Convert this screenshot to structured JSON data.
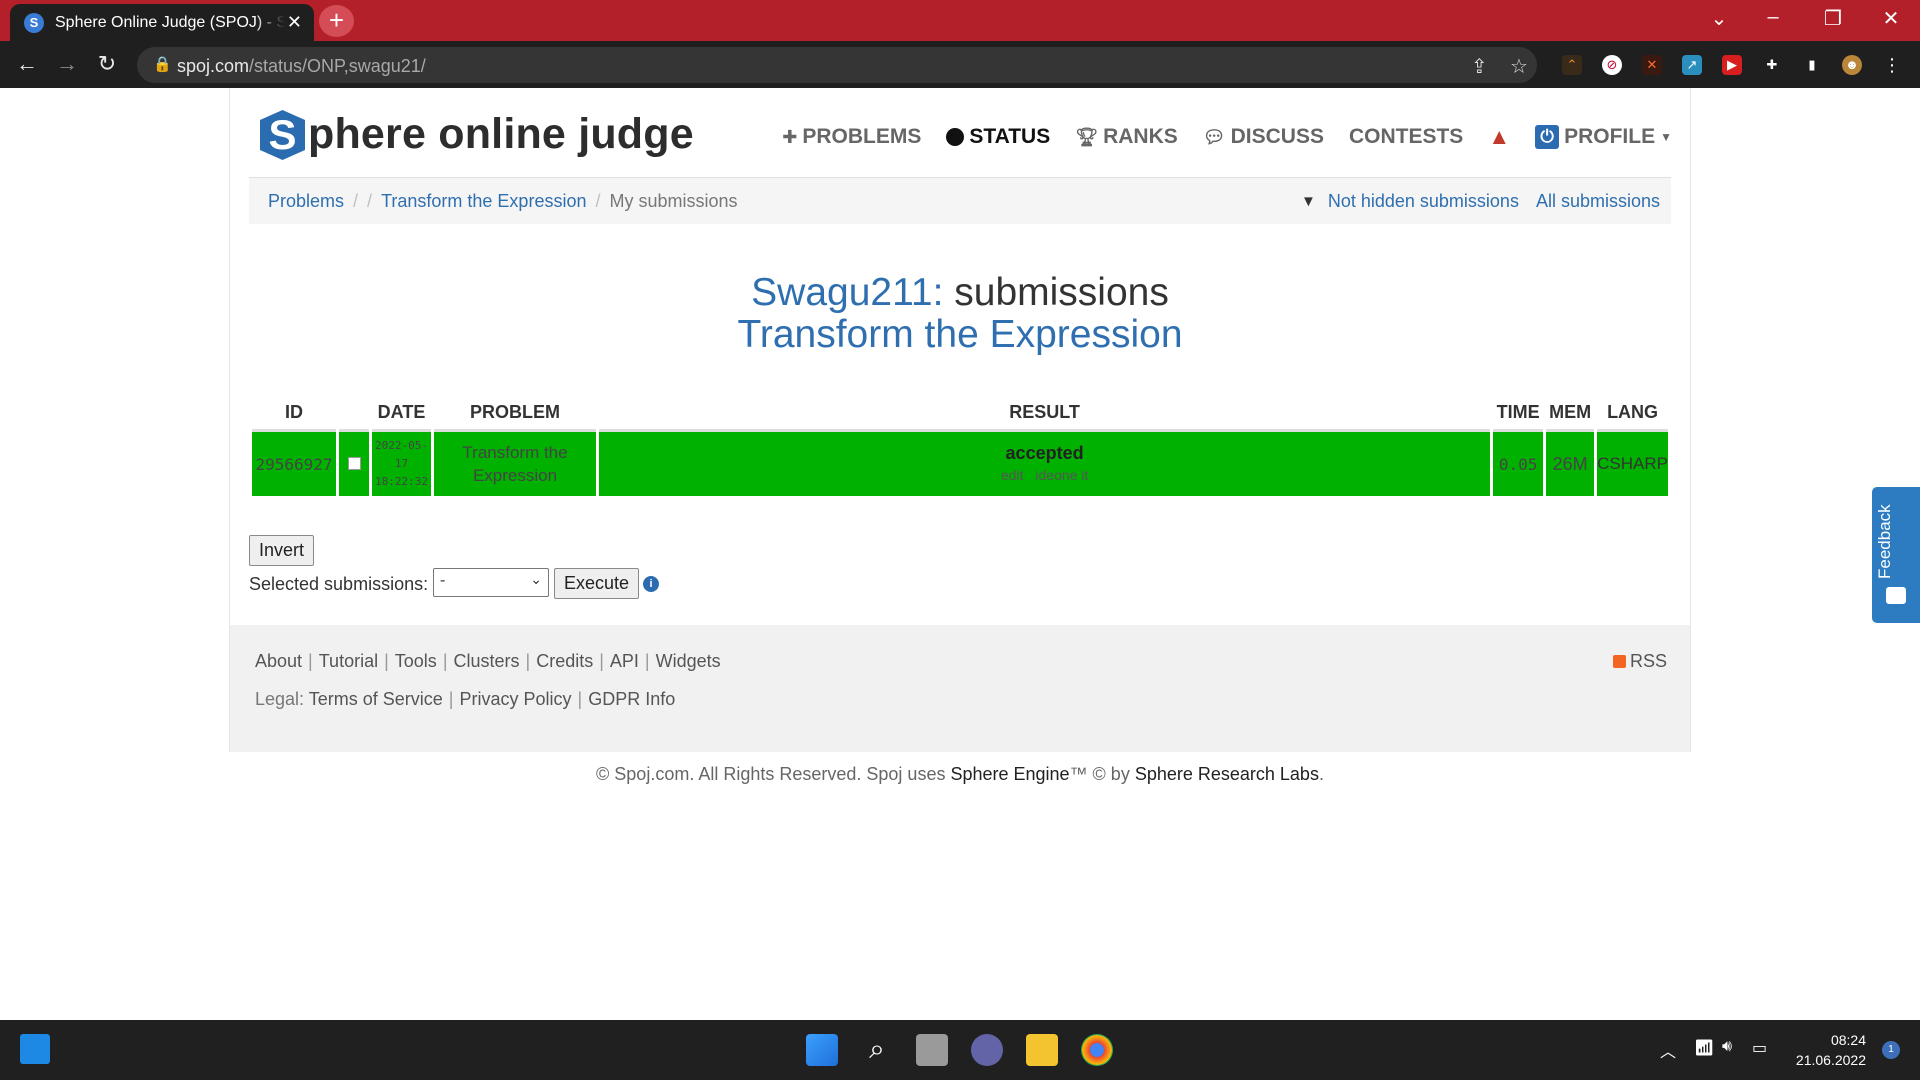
{
  "browser": {
    "tab_title": "Sphere Online Judge (SPOJ) - Status",
    "tab_favicon": "S",
    "new_tab": "+",
    "url_host": "spoj.com",
    "url_path": "/status/ONP,swagu21/"
  },
  "site": {
    "logo_letter": "S",
    "logo_text": "phere online judge",
    "nav": {
      "problems": "PROBLEMS",
      "status": "STATUS",
      "ranks": "RANKS",
      "discuss": "DISCUSS",
      "contests": "CONTESTS",
      "profile": "PROFILE"
    },
    "breadcrumb": {
      "problems": "Problems",
      "problem": "Transform the Expression",
      "current": "My submissions"
    },
    "filters": {
      "not_hidden": "Not hidden submissions",
      "all": "All submissions"
    },
    "heading": {
      "user": "Swagu211:",
      "word": "submissions",
      "problem": "Transform the Expression"
    },
    "table": {
      "headers": [
        "ID",
        "DATE",
        "PROBLEM",
        "RESULT",
        "TIME",
        "MEM",
        "LANG"
      ],
      "rows": [
        {
          "id": "29566927",
          "date": "2022-05-17",
          "time_of_day": "18:22:32",
          "problem": "Transform the Expression",
          "result": "accepted",
          "edit": "edit",
          "ideone": "ideone it",
          "time": "0.05",
          "mem": "26M",
          "lang": "CSHARP",
          "status_color": "#00b100"
        }
      ]
    },
    "invert_label": "Invert",
    "selected_label": "Selected submissions:",
    "select_value": "-",
    "execute_label": "Execute",
    "footer": {
      "links": [
        "About",
        "Tutorial",
        "Tools",
        "Clusters",
        "Credits",
        "API",
        "Widgets"
      ],
      "legal_prefix": "Legal:",
      "legal_links": [
        "Terms of Service",
        "Privacy Policy",
        "GDPR Info"
      ],
      "rss": "RSS"
    },
    "copyright": {
      "prefix": "© Spoj.com. All Rights Reserved. Spoj uses ",
      "engine": "Sphere Engine",
      "mid": "™ © by ",
      "labs": "Sphere Research Labs",
      "suffix": "."
    },
    "feedback": "Feedback"
  },
  "taskbar": {
    "time": "08:24",
    "date": "21.06.2022",
    "notifications": "1"
  },
  "colors": {
    "tab_strip": "#b3202a",
    "accent": "#2f6fb0",
    "accepted": "#00b100"
  }
}
